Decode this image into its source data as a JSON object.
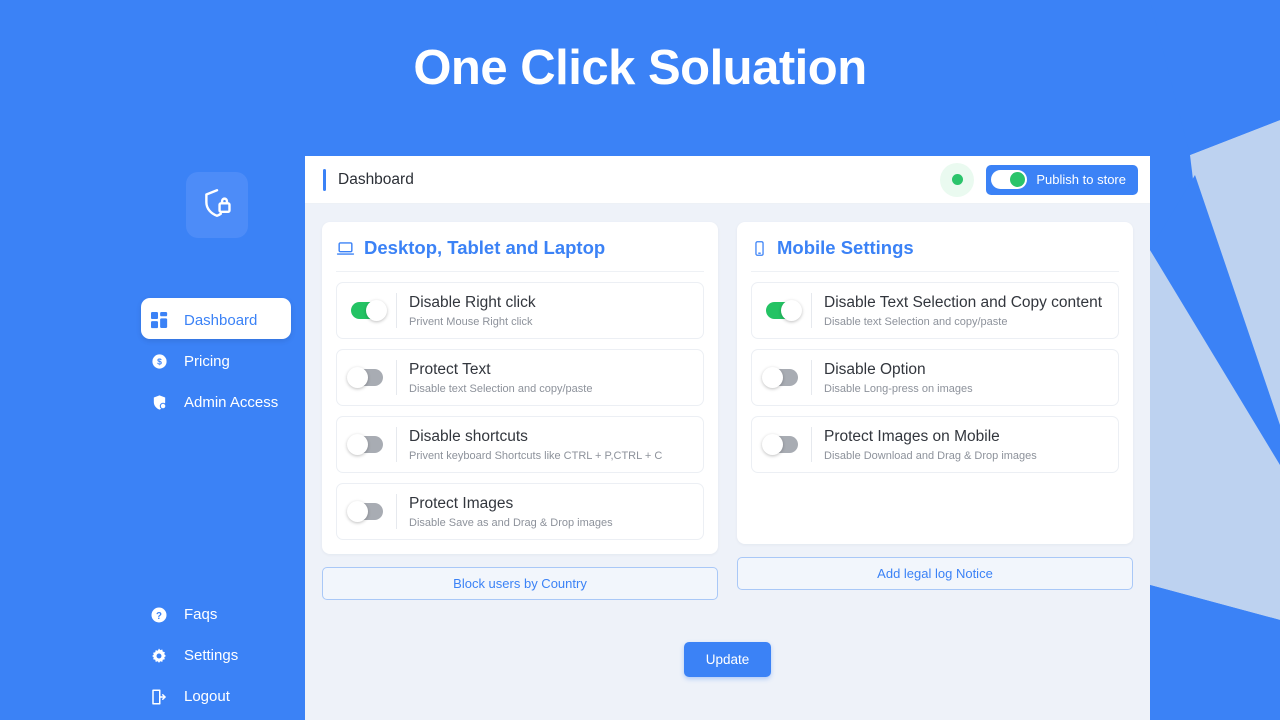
{
  "theme": {
    "brand_blue": "#3b82f6",
    "bg_blue": "#3b82f6",
    "shape_light": "#bdd2f0",
    "content_bg": "#eef2f9",
    "toggle_on": "#24c364",
    "toggle_off": "#a8acb3",
    "status_green": "#2bc46b"
  },
  "header": {
    "title": "One Click Soluation"
  },
  "sidebar": {
    "logo_icon": "shield-lock-icon",
    "items": [
      {
        "label": "Dashboard",
        "icon": "grid-dashboard-icon",
        "active": true
      },
      {
        "label": "Pricing",
        "icon": "dollar-coin-icon",
        "active": false
      },
      {
        "label": "Admin Access",
        "icon": "shield-user-icon",
        "active": false
      }
    ],
    "bottom_items": [
      {
        "label": "Faqs",
        "icon": "question-circle-icon"
      },
      {
        "label": "Settings",
        "icon": "gear-icon"
      },
      {
        "label": "Logout",
        "icon": "logout-arrow-icon"
      }
    ]
  },
  "topbar": {
    "title": "Dashboard",
    "status_dot": "active-status-dot",
    "publish_label": "Publish to store",
    "publish_state": "on"
  },
  "panels": [
    {
      "title": "Desktop, Tablet and Laptop",
      "icon": "laptop-icon",
      "settings": [
        {
          "title": "Disable Right click",
          "sub": "Privent Mouse Right click",
          "state": "on"
        },
        {
          "title": "Protect Text",
          "sub": "Disable text Selection and copy/paste",
          "state": "off"
        },
        {
          "title": "Disable shortcuts",
          "sub": "Privent keyboard Shortcuts like CTRL + P,CTRL + C",
          "state": "off"
        },
        {
          "title": "Protect Images",
          "sub": "Disable Save as and Drag & Drop images",
          "state": "off"
        }
      ],
      "action_label": "Block users by Country"
    },
    {
      "title": "Mobile Settings",
      "icon": "mobile-phone-icon",
      "settings": [
        {
          "title": "Disable Text Selection and Copy content",
          "sub": "Disable text Selection and copy/paste",
          "state": "on"
        },
        {
          "title": "Disable Option",
          "sub": "Disable Long-press on images",
          "state": "off"
        },
        {
          "title": "Protect Images on Mobile",
          "sub": "Disable Download and Drag & Drop images",
          "state": "off"
        }
      ],
      "action_label": "Add legal log Notice"
    }
  ],
  "footer": {
    "update_label": "Update"
  }
}
